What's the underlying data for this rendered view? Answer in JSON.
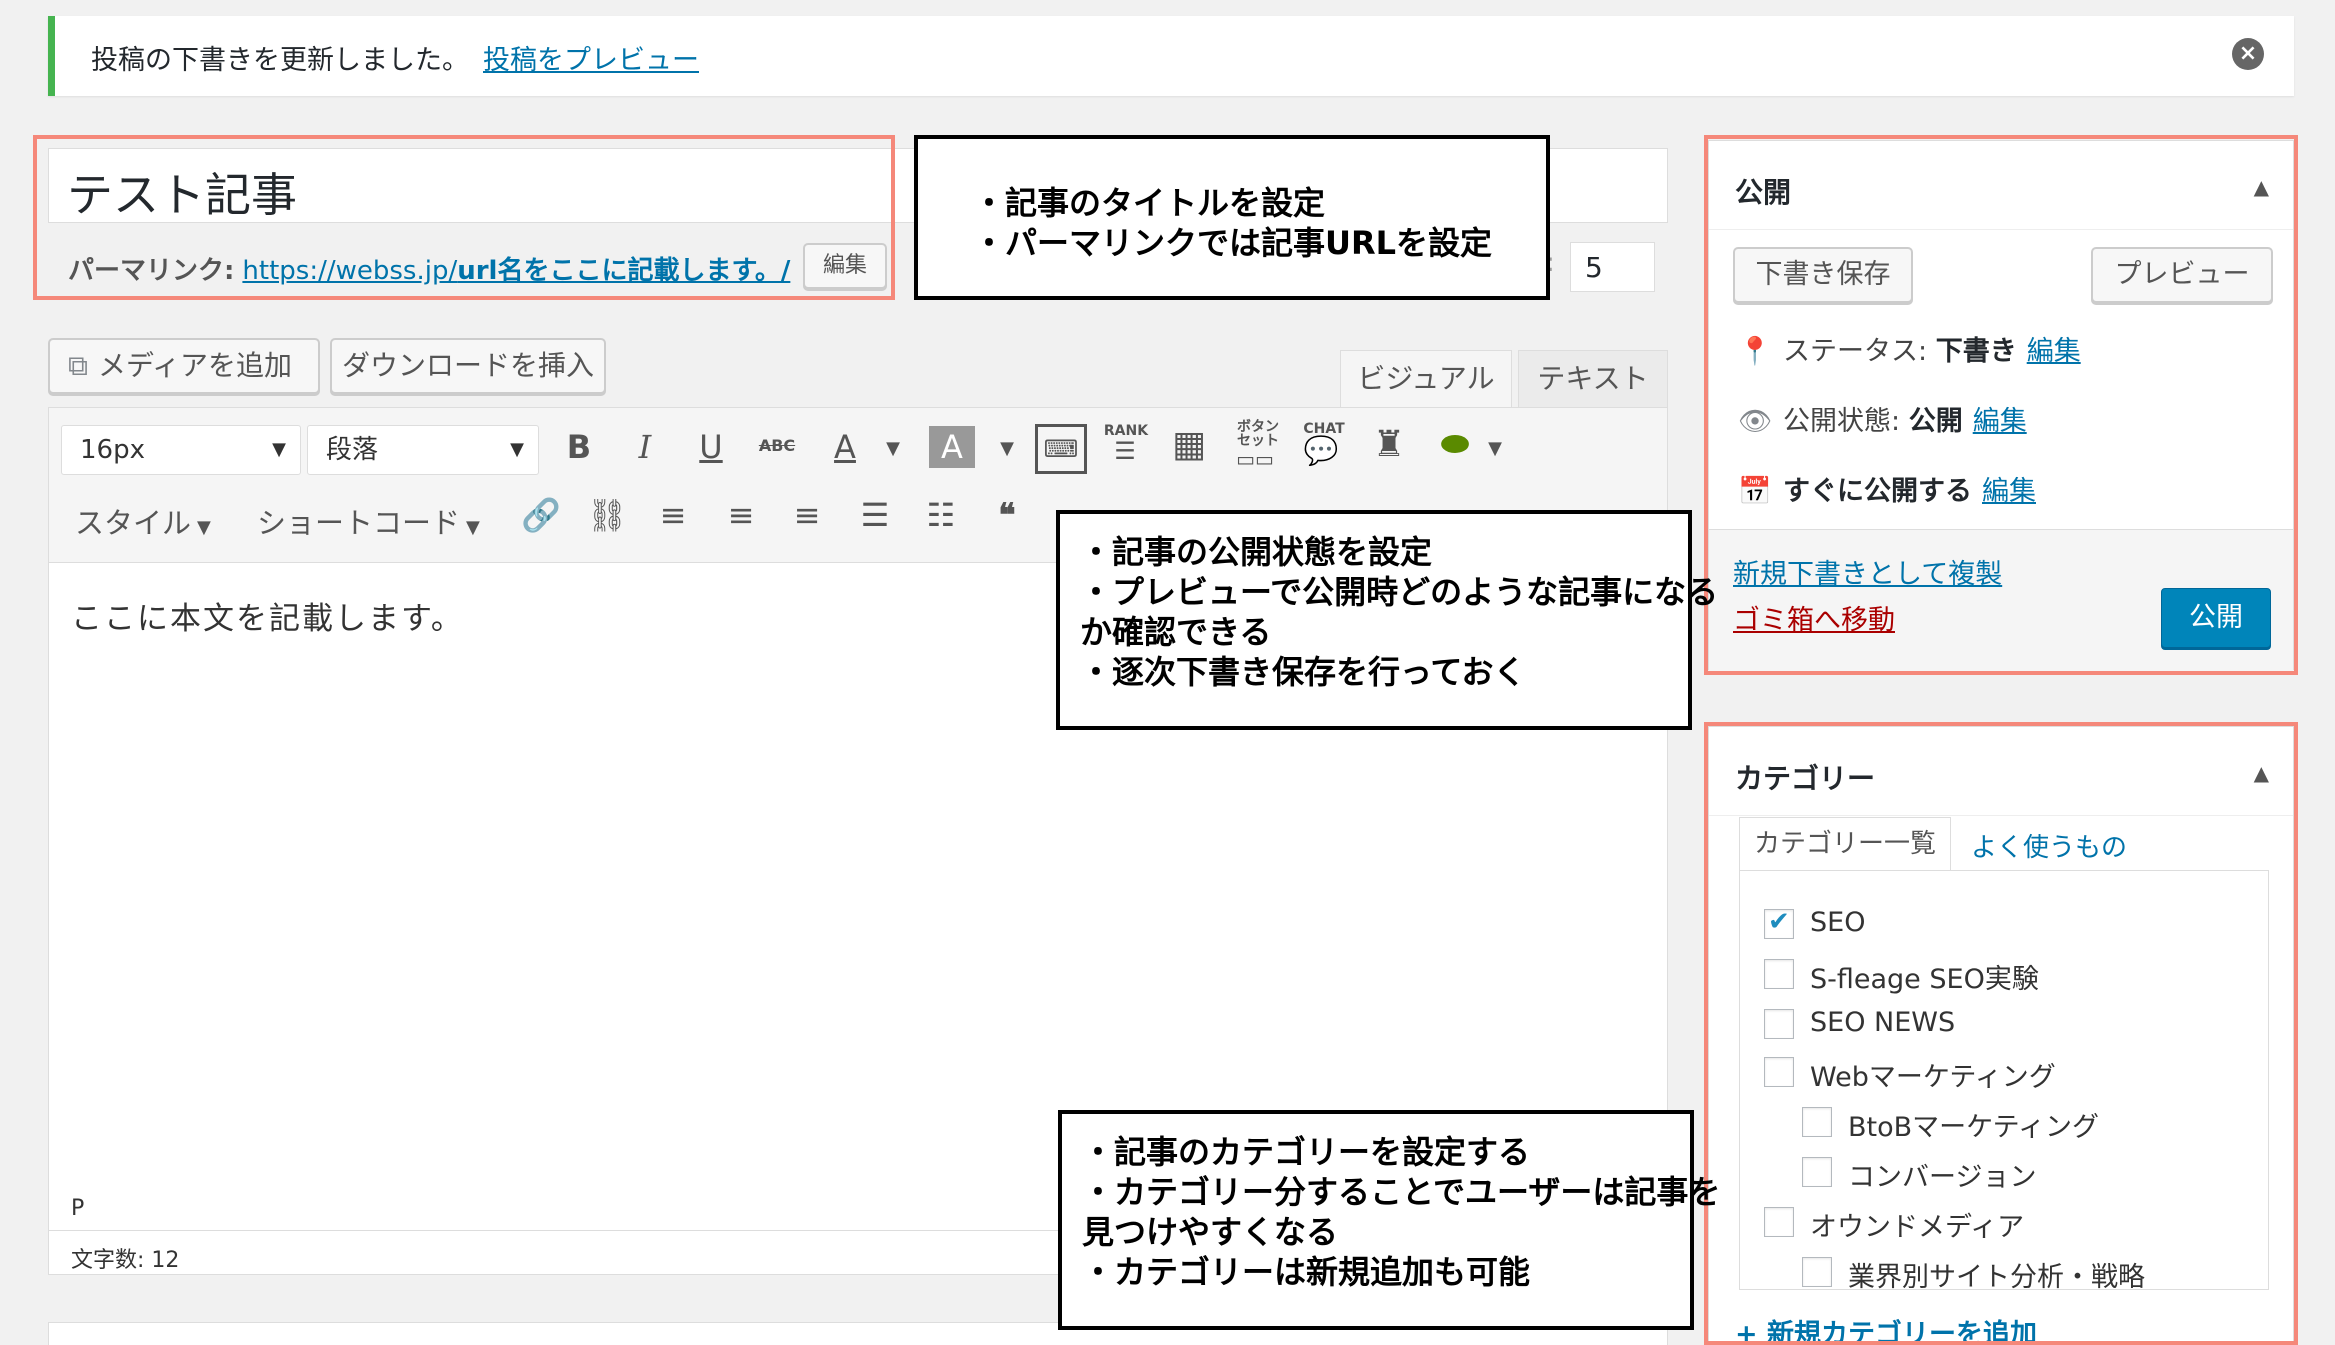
{
  "notice": {
    "message": "投稿の下書きを更新しました。",
    "link": "投稿をプレビュー",
    "close_icon": "close-circle-icon"
  },
  "post": {
    "title": "テスト記事",
    "permalink_label": "パーマリンク:",
    "permalink_base": "https://webss.jp/",
    "permalink_slug": "url名をここに記載します。/",
    "permalink_edit": "編集",
    "number_value": "5"
  },
  "media": {
    "add_media": "メディアを追加",
    "insert_download": "ダウンロードを挿入"
  },
  "editor": {
    "tabs": [
      "ビジュアル",
      "テキスト"
    ],
    "font_size": "16px",
    "format": "段落",
    "style_menu": "スタイル",
    "shortcode_menu": "ショートコード",
    "toolbar_labels": {
      "rank": "RANK",
      "button_set_1": "ボタン",
      "button_set_2": "セット",
      "chat": "CHAT"
    },
    "content": "ここに本文を記載します。",
    "path": "P",
    "word_count": "文字数: 12"
  },
  "publish_box": {
    "title": "公開",
    "save_draft": "下書き保存",
    "preview": "プレビュー",
    "status_label": "ステータス:",
    "status_value": "下書き",
    "visibility_label": "公開状態:",
    "visibility_value": "公開",
    "schedule_label": "すぐに公開する",
    "edit": "編集",
    "duplicate": "新規下書きとして複製",
    "trash": "ゴミ箱へ移動",
    "publish": "公開"
  },
  "category_box": {
    "title": "カテゴリー",
    "tab_all": "カテゴリー一覧",
    "tab_popular": "よく使うもの",
    "items": [
      {
        "label": "SEO",
        "checked": true,
        "level": 0
      },
      {
        "label": "S-fleage SEO実験",
        "checked": false,
        "level": 0
      },
      {
        "label": "SEO NEWS",
        "checked": false,
        "level": 0
      },
      {
        "label": "Webマーケティング",
        "checked": false,
        "level": 0
      },
      {
        "label": "BtoBマーケティング",
        "checked": false,
        "level": 1
      },
      {
        "label": "コンバージョン",
        "checked": false,
        "level": 1
      },
      {
        "label": "オウンドメディア",
        "checked": false,
        "level": 0
      },
      {
        "label": "業界別サイト分析・戦略",
        "checked": false,
        "level": 1
      }
    ],
    "add_new": "+ 新規カテゴリーを追加"
  },
  "annotations": {
    "title_callout": [
      "・記事のタイトルを設定",
      "・パーマリンクでは記事URLを設定"
    ],
    "publish_callout": [
      "・記事の公開状態を設定",
      "・プレビューで公開時どのような記事になる",
      "か確認できる",
      "・逐次下書き保存を行っておく"
    ],
    "category_callout": [
      "・記事のカテゴリーを設定する",
      "・カテゴリー分することでユーザーは記事を",
      "見つけやすくなる",
      "・カテゴリーは新規追加も可能"
    ]
  },
  "colors": {
    "accent": "#0073aa",
    "publish_button": "#0085ba",
    "highlight_border": "#f5887a",
    "notice_success": "#46b450",
    "trash": "#a00"
  }
}
